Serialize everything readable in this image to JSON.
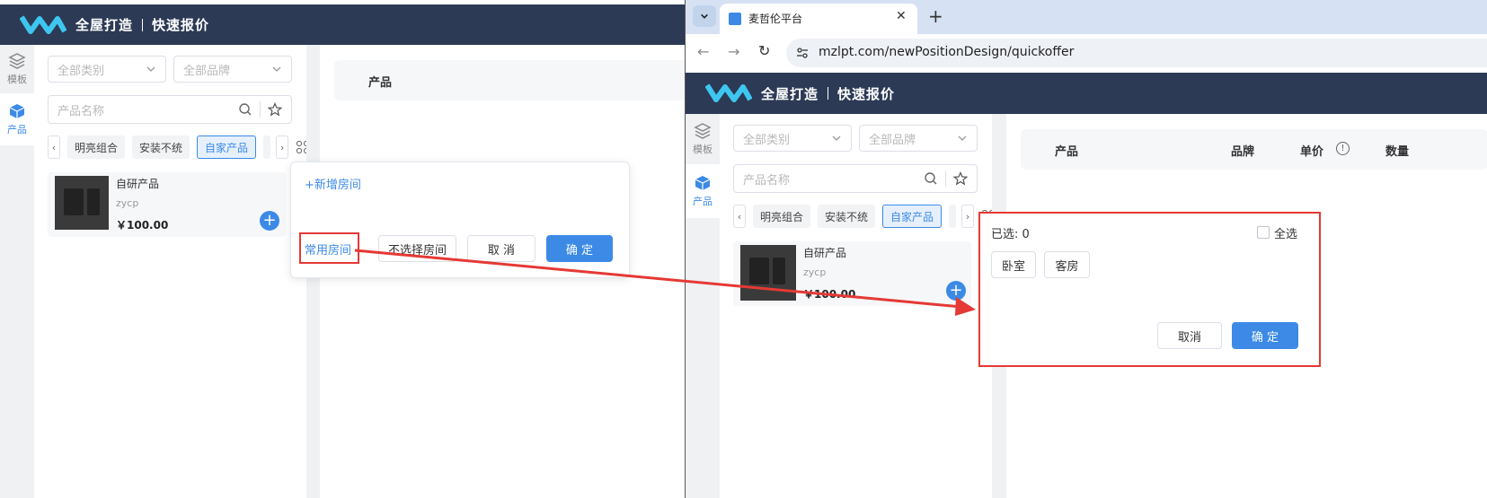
{
  "app": {
    "brand": "全屋打造",
    "section": "快速报价",
    "rail": {
      "template": "模板",
      "product": "产品"
    },
    "filters": {
      "category": "全部类别",
      "brand": "全部品牌"
    },
    "search_placeholder": "产品名称",
    "chips": [
      "明亮组合",
      "安装不统",
      "自家产品"
    ],
    "product": {
      "name": "自研产品",
      "code": "zycp",
      "price": "￥100.00"
    },
    "table_headers": {
      "product": "产品",
      "brand": "品牌",
      "unit_price": "单价",
      "qty": "数量"
    }
  },
  "left_popup": {
    "add_room": "+新增房间",
    "common_rooms": "常用房间",
    "no_room": "不选择房间",
    "cancel": "取 消",
    "confirm": "确 定"
  },
  "browser": {
    "tab_title": "麦哲伦平台",
    "url": "mzlpt.com/newPositionDesign/quickoffer"
  },
  "room_dialog": {
    "selected_label": "已选: 0",
    "select_all": "全选",
    "rooms": [
      "卧室",
      "客房"
    ],
    "cancel": "取消",
    "confirm": "确 定"
  },
  "colors": {
    "header": "#2c3a55",
    "accent": "#3c8ae6",
    "annotation": "#e53935"
  }
}
